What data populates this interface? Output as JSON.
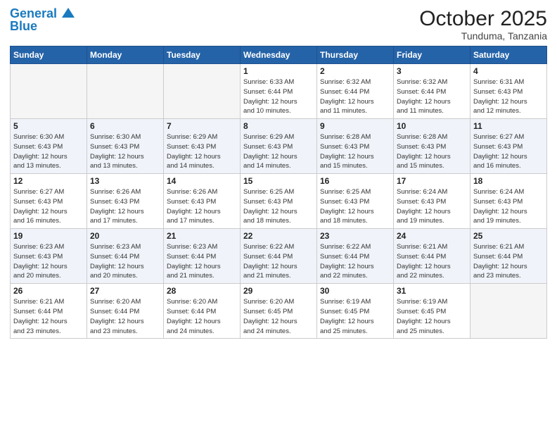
{
  "header": {
    "logo_line1": "General",
    "logo_line2": "Blue",
    "month_title": "October 2025",
    "location": "Tunduma, Tanzania"
  },
  "weekdays": [
    "Sunday",
    "Monday",
    "Tuesday",
    "Wednesday",
    "Thursday",
    "Friday",
    "Saturday"
  ],
  "weeks": [
    [
      {
        "day": "",
        "empty": true
      },
      {
        "day": "",
        "empty": true
      },
      {
        "day": "",
        "empty": true
      },
      {
        "day": "1",
        "sunrise": "6:33 AM",
        "sunset": "6:44 PM",
        "daylight": "12 hours and 10 minutes."
      },
      {
        "day": "2",
        "sunrise": "6:32 AM",
        "sunset": "6:44 PM",
        "daylight": "12 hours and 11 minutes."
      },
      {
        "day": "3",
        "sunrise": "6:32 AM",
        "sunset": "6:44 PM",
        "daylight": "12 hours and 11 minutes."
      },
      {
        "day": "4",
        "sunrise": "6:31 AM",
        "sunset": "6:43 PM",
        "daylight": "12 hours and 12 minutes."
      }
    ],
    [
      {
        "day": "5",
        "sunrise": "6:30 AM",
        "sunset": "6:43 PM",
        "daylight": "12 hours and 13 minutes."
      },
      {
        "day": "6",
        "sunrise": "6:30 AM",
        "sunset": "6:43 PM",
        "daylight": "12 hours and 13 minutes."
      },
      {
        "day": "7",
        "sunrise": "6:29 AM",
        "sunset": "6:43 PM",
        "daylight": "12 hours and 14 minutes."
      },
      {
        "day": "8",
        "sunrise": "6:29 AM",
        "sunset": "6:43 PM",
        "daylight": "12 hours and 14 minutes."
      },
      {
        "day": "9",
        "sunrise": "6:28 AM",
        "sunset": "6:43 PM",
        "daylight": "12 hours and 15 minutes."
      },
      {
        "day": "10",
        "sunrise": "6:28 AM",
        "sunset": "6:43 PM",
        "daylight": "12 hours and 15 minutes."
      },
      {
        "day": "11",
        "sunrise": "6:27 AM",
        "sunset": "6:43 PM",
        "daylight": "12 hours and 16 minutes."
      }
    ],
    [
      {
        "day": "12",
        "sunrise": "6:27 AM",
        "sunset": "6:43 PM",
        "daylight": "12 hours and 16 minutes."
      },
      {
        "day": "13",
        "sunrise": "6:26 AM",
        "sunset": "6:43 PM",
        "daylight": "12 hours and 17 minutes."
      },
      {
        "day": "14",
        "sunrise": "6:26 AM",
        "sunset": "6:43 PM",
        "daylight": "12 hours and 17 minutes."
      },
      {
        "day": "15",
        "sunrise": "6:25 AM",
        "sunset": "6:43 PM",
        "daylight": "12 hours and 18 minutes."
      },
      {
        "day": "16",
        "sunrise": "6:25 AM",
        "sunset": "6:43 PM",
        "daylight": "12 hours and 18 minutes."
      },
      {
        "day": "17",
        "sunrise": "6:24 AM",
        "sunset": "6:43 PM",
        "daylight": "12 hours and 19 minutes."
      },
      {
        "day": "18",
        "sunrise": "6:24 AM",
        "sunset": "6:43 PM",
        "daylight": "12 hours and 19 minutes."
      }
    ],
    [
      {
        "day": "19",
        "sunrise": "6:23 AM",
        "sunset": "6:43 PM",
        "daylight": "12 hours and 20 minutes."
      },
      {
        "day": "20",
        "sunrise": "6:23 AM",
        "sunset": "6:44 PM",
        "daylight": "12 hours and 20 minutes."
      },
      {
        "day": "21",
        "sunrise": "6:23 AM",
        "sunset": "6:44 PM",
        "daylight": "12 hours and 21 minutes."
      },
      {
        "day": "22",
        "sunrise": "6:22 AM",
        "sunset": "6:44 PM",
        "daylight": "12 hours and 21 minutes."
      },
      {
        "day": "23",
        "sunrise": "6:22 AM",
        "sunset": "6:44 PM",
        "daylight": "12 hours and 22 minutes."
      },
      {
        "day": "24",
        "sunrise": "6:21 AM",
        "sunset": "6:44 PM",
        "daylight": "12 hours and 22 minutes."
      },
      {
        "day": "25",
        "sunrise": "6:21 AM",
        "sunset": "6:44 PM",
        "daylight": "12 hours and 23 minutes."
      }
    ],
    [
      {
        "day": "26",
        "sunrise": "6:21 AM",
        "sunset": "6:44 PM",
        "daylight": "12 hours and 23 minutes."
      },
      {
        "day": "27",
        "sunrise": "6:20 AM",
        "sunset": "6:44 PM",
        "daylight": "12 hours and 23 minutes."
      },
      {
        "day": "28",
        "sunrise": "6:20 AM",
        "sunset": "6:44 PM",
        "daylight": "12 hours and 24 minutes."
      },
      {
        "day": "29",
        "sunrise": "6:20 AM",
        "sunset": "6:45 PM",
        "daylight": "12 hours and 24 minutes."
      },
      {
        "day": "30",
        "sunrise": "6:19 AM",
        "sunset": "6:45 PM",
        "daylight": "12 hours and 25 minutes."
      },
      {
        "day": "31",
        "sunrise": "6:19 AM",
        "sunset": "6:45 PM",
        "daylight": "12 hours and 25 minutes."
      },
      {
        "day": "",
        "empty": true
      }
    ]
  ]
}
